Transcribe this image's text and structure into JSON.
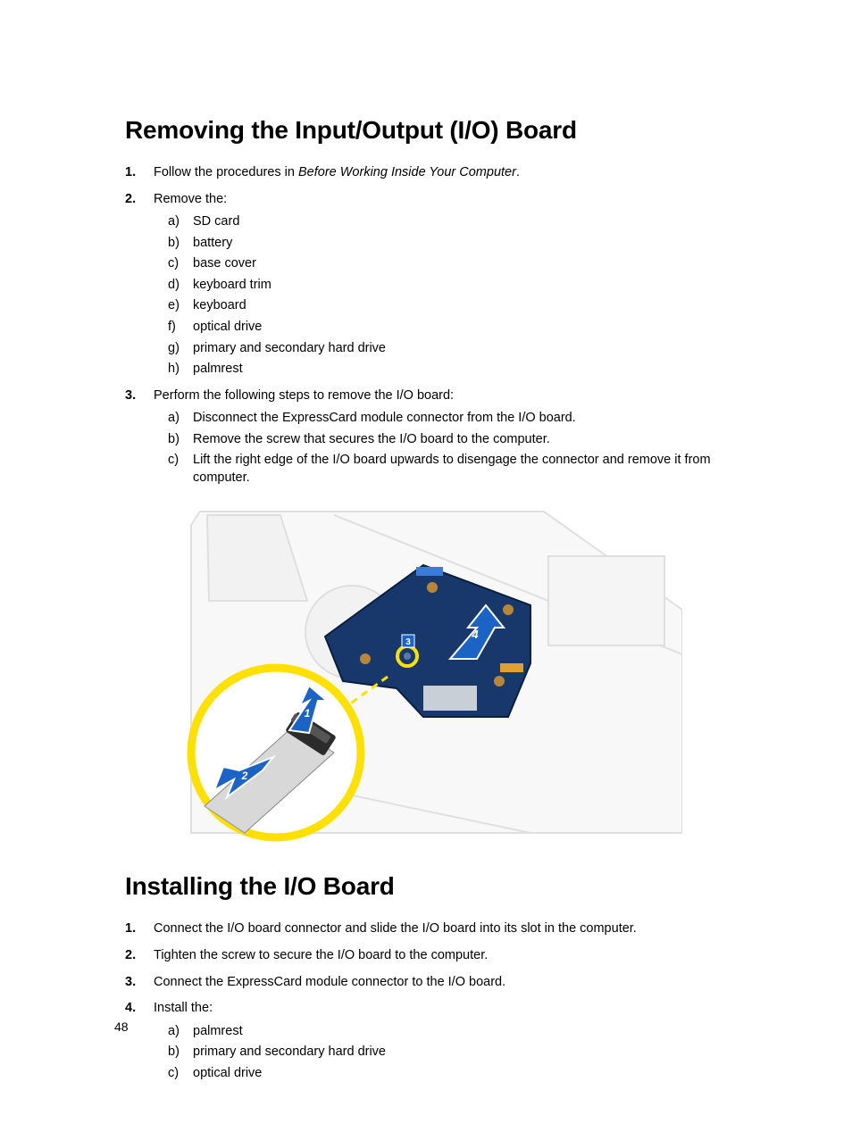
{
  "page_number": "48",
  "sections": [
    {
      "heading": "Removing the Input/Output (I/O) Board",
      "steps": [
        {
          "text_parts": [
            "Follow the procedures in ",
            "Before Working Inside Your Computer",
            "."
          ]
        },
        {
          "text": "Remove the:",
          "subitems": [
            "SD card",
            "battery",
            "base cover",
            "keyboard trim",
            "keyboard",
            "optical drive",
            "primary and secondary hard drive",
            "palmrest"
          ]
        },
        {
          "text": "Perform the following steps to remove the I/O board:",
          "subitems": [
            "Disconnect the ExpressCard module connector from the I/O board.",
            "Remove the screw that secures the I/O board to the computer.",
            "Lift the right edge of the I/O board upwards to disengage the connector and remove it from computer."
          ]
        }
      ]
    },
    {
      "heading": "Installing the I/O Board",
      "steps": [
        {
          "text": "Connect the I/O board connector and slide the I/O board into its slot in the computer."
        },
        {
          "text": "Tighten the screw to secure the I/O board to the computer."
        },
        {
          "text": "Connect the ExpressCard module connector to the I/O board."
        },
        {
          "text": "Install the:",
          "subitems": [
            "palmrest",
            "primary and secondary hard drive",
            "optical drive"
          ]
        }
      ]
    }
  ],
  "figure_callouts": [
    "1",
    "2",
    "3",
    "4"
  ]
}
